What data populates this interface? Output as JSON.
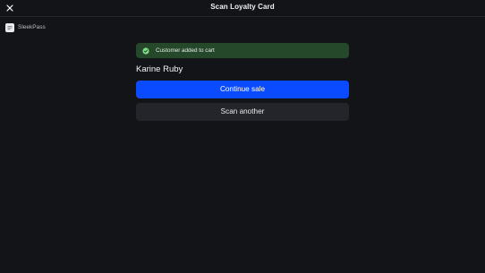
{
  "header": {
    "title": "Scan Loyalty Card",
    "close_icon": "close-icon"
  },
  "brand": {
    "name": "SleekPass",
    "logo_icon": "sleekpass-logo-icon"
  },
  "toast": {
    "message": "Customer added to cart",
    "icon": "check-circle-icon",
    "color": "#25472a"
  },
  "customer": {
    "name": "Karine Ruby"
  },
  "actions": {
    "continue_label": "Continue sale",
    "scan_another_label": "Scan another",
    "primary_color": "#0a4bff"
  }
}
